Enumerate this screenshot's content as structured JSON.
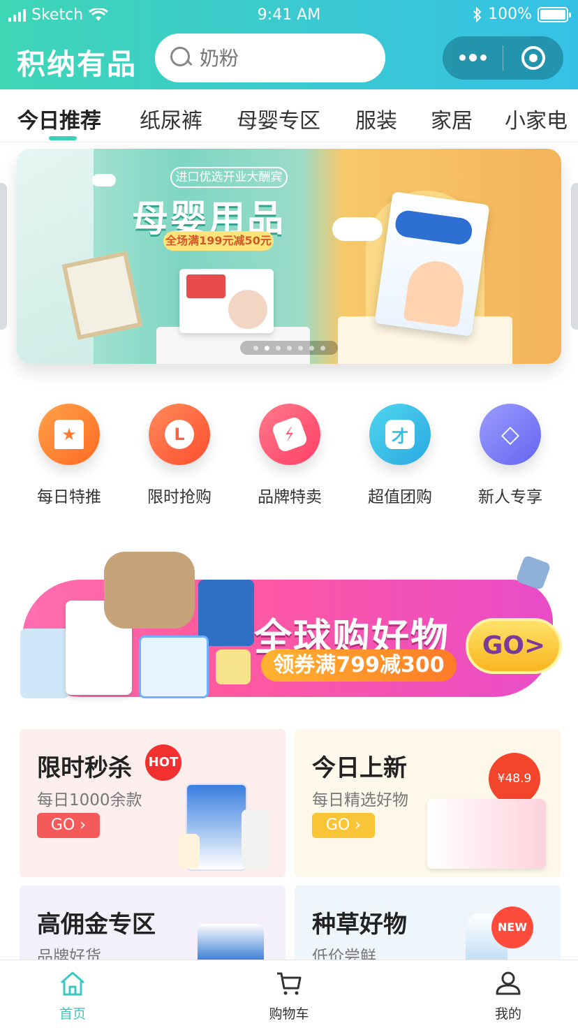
{
  "status_bar": {
    "carrier": "Sketch",
    "time": "9:41 AM",
    "battery": "100%"
  },
  "header": {
    "brand": "积纳有品",
    "search_placeholder": "奶粉"
  },
  "tabs": [
    {
      "label": "今日推荐",
      "active": true
    },
    {
      "label": "纸尿裤"
    },
    {
      "label": "母婴专区"
    },
    {
      "label": "服装"
    },
    {
      "label": "家居"
    },
    {
      "label": "小家电"
    }
  ],
  "hero": {
    "tag": "进口优选开业大酬宾",
    "title": "母婴用品",
    "promo": "全场满199元减50元",
    "slide_count": 7,
    "active_slide": 1
  },
  "icon_nav": [
    {
      "label": "每日特推",
      "icon": "star-bookmark-icon",
      "color": "#ff7a2e"
    },
    {
      "label": "限时抢购",
      "icon": "alarm-clock-icon",
      "color": "#ff6040"
    },
    {
      "label": "品牌特卖",
      "icon": "tag-icon",
      "color": "#ff4f6d"
    },
    {
      "label": "超值团购",
      "icon": "group-buy-icon",
      "color": "#33bde6"
    },
    {
      "label": "新人专享",
      "icon": "diamond-icon",
      "color": "#7c7dff"
    }
  ],
  "promo_banner": {
    "title": "全球购好物",
    "coupon": "领券满799减300",
    "go": "GO>"
  },
  "cards": [
    {
      "title": "限时秒杀",
      "subtitle": "每日1000余款",
      "go": "GO ›",
      "badge": "HOT",
      "bg": "#fdeeee",
      "go_color": "#f55a5a"
    },
    {
      "title": "今日上新",
      "subtitle": "每日精选好物",
      "go": "GO ›",
      "badge": "¥48.9",
      "bg": "#fdf8e9",
      "go_color": "#f7c535"
    },
    {
      "title": "高佣金专区",
      "subtitle": "品牌好货",
      "bg": "#f4f0fb"
    },
    {
      "title": "种草好物",
      "subtitle": "低价尝鲜",
      "badge": "NEW",
      "bg": "#eef6fb"
    }
  ],
  "tabbar": [
    {
      "label": "首页",
      "icon": "home-icon",
      "active": true
    },
    {
      "label": "购物车",
      "icon": "cart-icon"
    },
    {
      "label": "我的",
      "icon": "user-icon"
    }
  ],
  "colors": {
    "accent": "#3cd0b9",
    "header_start": "#3fd6b6",
    "header_end": "#35c1e6"
  }
}
